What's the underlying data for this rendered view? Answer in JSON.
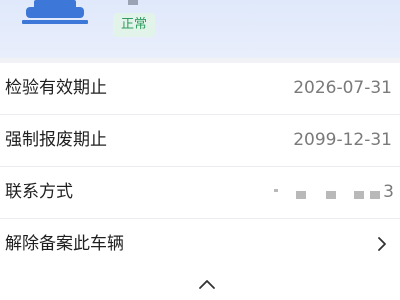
{
  "status": {
    "badge": "正常",
    "badge_color": "#2f9b5e"
  },
  "info": {
    "rows": [
      {
        "label": "检验有效期止",
        "value": "2026-07-31"
      },
      {
        "label": "强制报废期止",
        "value": "2099-12-31"
      },
      {
        "label": "联系方式",
        "value_tail": "3"
      },
      {
        "label": "解除备案此车辆"
      }
    ]
  },
  "icons": {
    "vehicle": "car-icon",
    "row_action": "chevron-right-icon",
    "collapse": "chevron-up-icon"
  },
  "colors": {
    "accent": "#3d78d8",
    "text_primary": "#1f1f1f",
    "text_secondary": "#7a7a7a"
  }
}
